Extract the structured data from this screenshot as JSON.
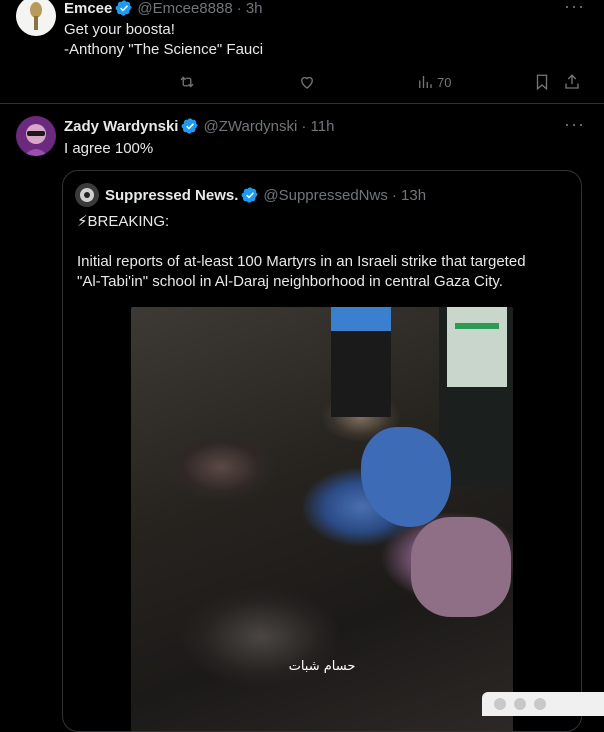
{
  "post1": {
    "name": "Emcee",
    "handle": "@Emcee8888",
    "time": "· 3h",
    "more": "···",
    "text_line1": "Get your boosta!",
    "text_line2": "-Anthony \"The Science\" Fauci",
    "views": "70"
  },
  "post2": {
    "name": "Zady Wardynski",
    "handle": "@ZWardynski",
    "time": "· 11h",
    "more": "···",
    "text": "I agree 100%"
  },
  "quote": {
    "name": "Suppressed News.",
    "handle": "@SuppressedNws",
    "time": "· 13h",
    "breaking": "⚡BREAKING:",
    "body_line1": "Initial reports of at-least 100 Martyrs in an Israeli strike that targeted",
    "body_line2": "\"Al-Tabi'in\" school in Al-Daraj neighborhood in central Gaza City.",
    "media_caption": "حسام شبات"
  },
  "icons": {
    "retweet": "retweet-icon",
    "like": "heart-icon",
    "views": "views-icon",
    "bookmark": "bookmark-icon",
    "share": "share-icon",
    "verified": "verified-badge-icon"
  },
  "colors": {
    "background": "#000000",
    "text": "#e7e9ea",
    "muted": "#71767b",
    "verified": "#1d9bf0",
    "border": "#2f3336"
  }
}
